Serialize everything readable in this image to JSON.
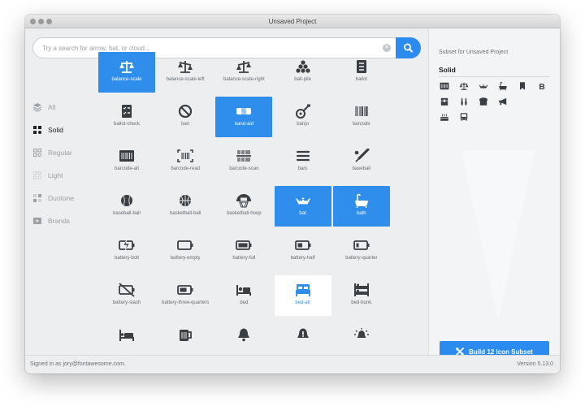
{
  "window": {
    "title": "Unsaved Project"
  },
  "search": {
    "placeholder": "Try a search for arrow, bat, or cloud...",
    "value": ""
  },
  "sidebar": {
    "items": [
      {
        "label": "All",
        "icon": "layers-icon",
        "active": false
      },
      {
        "label": "Solid",
        "icon": "solid-style-icon",
        "active": true
      },
      {
        "label": "Regular",
        "icon": "regular-style-icon",
        "active": false
      },
      {
        "label": "Light",
        "icon": "light-style-icon",
        "active": false
      },
      {
        "label": "Duotone",
        "icon": "duotone-style-icon",
        "active": false
      },
      {
        "label": "Brands",
        "icon": "brands-icon",
        "active": false
      }
    ]
  },
  "grid": {
    "icons": [
      {
        "label": "balance-scale",
        "state": "selected"
      },
      {
        "label": "balance-scale-left",
        "state": ""
      },
      {
        "label": "balance-scale-right",
        "state": ""
      },
      {
        "label": "ball-pile",
        "state": ""
      },
      {
        "label": "ballot",
        "state": ""
      },
      {
        "label": "ballot-check",
        "state": ""
      },
      {
        "label": "ban",
        "state": ""
      },
      {
        "label": "band-aid",
        "state": "selected"
      },
      {
        "label": "banjo",
        "state": ""
      },
      {
        "label": "barcode",
        "state": ""
      },
      {
        "label": "barcode-alt",
        "state": ""
      },
      {
        "label": "barcode-read",
        "state": ""
      },
      {
        "label": "barcode-scan",
        "state": ""
      },
      {
        "label": "bars",
        "state": ""
      },
      {
        "label": "baseball",
        "state": ""
      },
      {
        "label": "baseball-ball",
        "state": ""
      },
      {
        "label": "basketball-ball",
        "state": ""
      },
      {
        "label": "basketball-hoop",
        "state": ""
      },
      {
        "label": "bat",
        "state": "selected"
      },
      {
        "label": "bath",
        "state": "selected"
      },
      {
        "label": "battery-bolt",
        "state": ""
      },
      {
        "label": "battery-empty",
        "state": ""
      },
      {
        "label": "battery-full",
        "state": ""
      },
      {
        "label": "battery-half",
        "state": ""
      },
      {
        "label": "battery-quarter",
        "state": ""
      },
      {
        "label": "battery-slash",
        "state": ""
      },
      {
        "label": "battery-three-quarters",
        "state": ""
      },
      {
        "label": "bed",
        "state": ""
      },
      {
        "label": "bed-alt",
        "state": "hover"
      },
      {
        "label": "bed-bunk",
        "state": ""
      },
      {
        "label": "",
        "state": ""
      },
      {
        "label": "",
        "state": ""
      },
      {
        "label": "",
        "state": ""
      },
      {
        "label": "",
        "state": ""
      },
      {
        "label": "",
        "state": ""
      }
    ]
  },
  "subset": {
    "title": "Subset for Unsaved Project",
    "style": "Solid",
    "build_label": "Build 12 Icon Subset"
  },
  "footer": {
    "signed_in": "Signed in as jory@fontawesome.com.",
    "version": "Version 5.13.0"
  },
  "colors": {
    "accent": "#2b8bee",
    "icon": "#3a3f44",
    "muted": "#9ba1a6"
  }
}
